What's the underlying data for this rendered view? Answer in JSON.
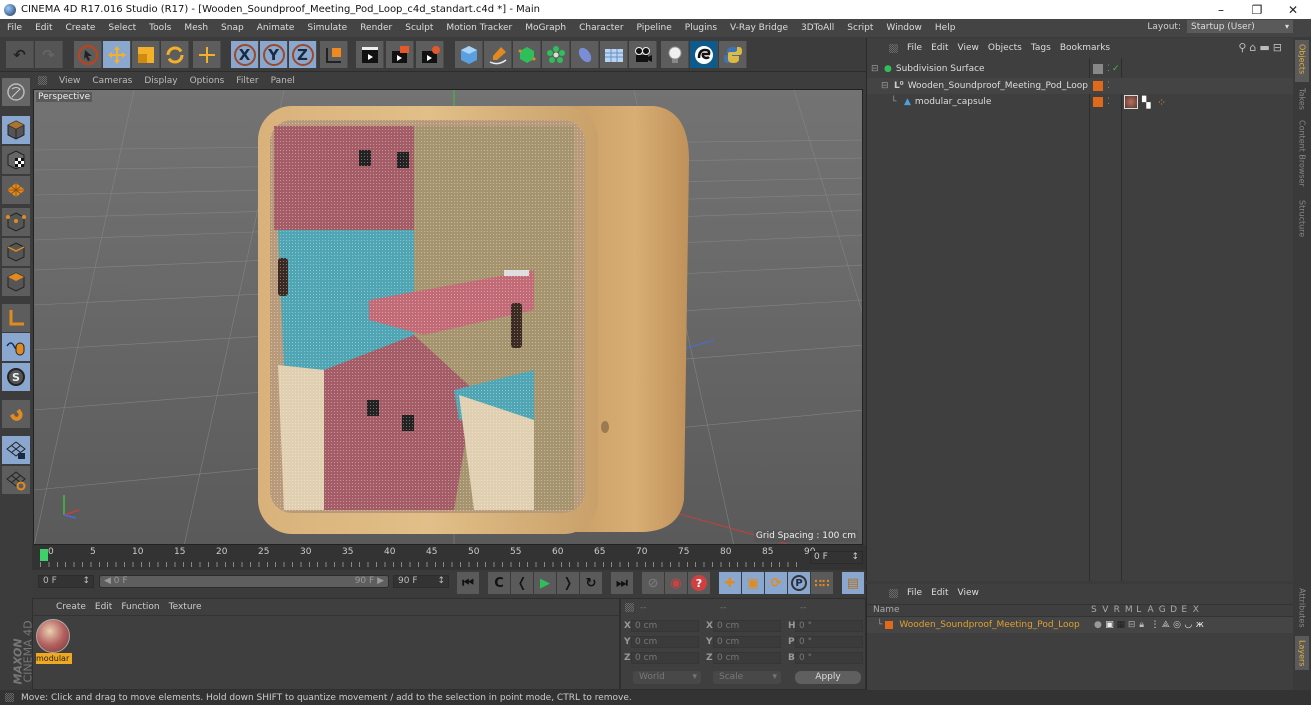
{
  "window": {
    "title": "CINEMA 4D R17.016 Studio (R17) - [Wooden_Soundproof_Meeting_Pod_Loop_c4d_standart.c4d *] - Main",
    "controls": [
      "minimize",
      "restore",
      "close"
    ]
  },
  "menubar": {
    "items": [
      "File",
      "Edit",
      "Create",
      "Select",
      "Tools",
      "Mesh",
      "Snap",
      "Animate",
      "Simulate",
      "Render",
      "Sculpt",
      "Motion Tracker",
      "MoGraph",
      "Character",
      "Pipeline",
      "Plugins",
      "V-Ray Bridge",
      "3DToAll",
      "Script",
      "Window",
      "Help"
    ],
    "layout_label": "Layout:",
    "layout_value": "Startup (User)"
  },
  "toolbar": {
    "icons": [
      "undo-icon",
      "redo-icon",
      "live-selection-icon",
      "move-icon",
      "scale-icon",
      "rotate-icon",
      "recent-tool-icon",
      "x-axis-icon",
      "y-axis-icon",
      "z-axis-icon",
      "coordinate-system-icon",
      "render-view-icon",
      "render-picture-viewer-icon",
      "edit-render-settings-icon",
      "cube-icon",
      "pen-spline-icon",
      "subdivision-icon",
      "cloner-icon",
      "deformer-icon",
      "floor-icon",
      "camera-icon",
      "light-icon",
      "3dtoall-icon",
      "python-icon"
    ]
  },
  "left_tools": {
    "icons": [
      "make-editable-icon",
      "model-mode-icon",
      "texture-mode-icon",
      "workplane-icon",
      "points-mode-icon",
      "edges-mode-icon",
      "polygons-mode-icon",
      "axis-mode-icon",
      "tweak-mode-icon",
      "solo-icon",
      "snap-icon",
      "locked-workplane-icon",
      "planar-workplane-icon"
    ]
  },
  "viewport": {
    "menu": [
      "View",
      "Cameras",
      "Display",
      "Options",
      "Filter",
      "Panel"
    ],
    "camera_label": "Perspective",
    "grid_spacing": "Grid Spacing : 100 cm",
    "nav_icons": [
      "move-view-icon",
      "zoom-view-icon",
      "rotate-view-icon",
      "maximize-view-icon"
    ]
  },
  "timeline": {
    "ticks": [
      "0",
      "5",
      "10",
      "15",
      "20",
      "25",
      "30",
      "35",
      "40",
      "45",
      "50",
      "55",
      "60",
      "65",
      "70",
      "75",
      "80",
      "85",
      "90"
    ],
    "current_frame": "0 F",
    "start_field": "0 F",
    "range_start": "0 F",
    "range_end": "90 F",
    "end_field": "90 F"
  },
  "transport": {
    "icons": [
      "go-to-start-icon",
      "previous-key-icon",
      "previous-frame-icon",
      "play-icon",
      "next-frame-icon",
      "next-key-icon",
      "go-to-end-icon",
      "record-icon",
      "auto-key-icon",
      "keyframe-selection-icon",
      "key-position-icon",
      "key-scale-icon",
      "key-rotation-icon",
      "key-parameter-icon",
      "key-pla-icon",
      "timeline-icon"
    ]
  },
  "material_panel": {
    "menu": [
      "Create",
      "Edit",
      "Function",
      "Texture"
    ],
    "materials": [
      {
        "name": "modular"
      }
    ]
  },
  "coordinates": {
    "headers": [
      "--",
      "--",
      "--"
    ],
    "rows": [
      {
        "pos_label": "X",
        "pos": "0 cm",
        "size_label": "X",
        "size": "0 cm",
        "rot_label": "H",
        "rot": "0 °"
      },
      {
        "pos_label": "Y",
        "pos": "0 cm",
        "size_label": "Y",
        "size": "0 cm",
        "rot_label": "P",
        "rot": "0 °"
      },
      {
        "pos_label": "Z",
        "pos": "0 cm",
        "size_label": "Z",
        "size": "0 cm",
        "rot_label": "B",
        "rot": "0 °"
      }
    ],
    "mode": "World",
    "size_mode": "Scale",
    "apply": "Apply"
  },
  "object_manager": {
    "menu": [
      "File",
      "Edit",
      "View",
      "Objects",
      "Tags",
      "Bookmarks"
    ],
    "objects": [
      {
        "name": "Subdivision Surface",
        "icon": "subdivision-surface-icon",
        "level": 0
      },
      {
        "name": "Wooden_Soundproof_Meeting_Pod_Loop",
        "icon": "null-object-icon",
        "level": 1
      },
      {
        "name": "modular_capsule",
        "icon": "polygon-object-icon",
        "level": 2
      }
    ]
  },
  "layer_manager": {
    "menu": [
      "File",
      "Edit",
      "View"
    ],
    "columns": [
      "Name",
      "S",
      "V",
      "R",
      "M",
      "L",
      "A",
      "G",
      "D",
      "E",
      "X"
    ],
    "layers": [
      {
        "name": "Wooden_Soundproof_Meeting_Pod_Loop",
        "color": "#e06a1a"
      }
    ]
  },
  "side_tabs": {
    "top": [
      "Objects",
      "Takes",
      "Content Browser",
      "Structure"
    ],
    "bottom": [
      "Attributes",
      "Layers"
    ]
  },
  "branding": {
    "maxon": "MAXON",
    "product": "CINEMA 4D"
  },
  "status": "Move: Click and drag to move elements. Hold down SHIFT to quantize movement / add to the selection in point mode, CTRL to remove.",
  "colors": {
    "accent": "#8aa8cf",
    "orange": "#e06a1a",
    "layer_text": "#e0a030",
    "tab_active": "#e0b040"
  }
}
